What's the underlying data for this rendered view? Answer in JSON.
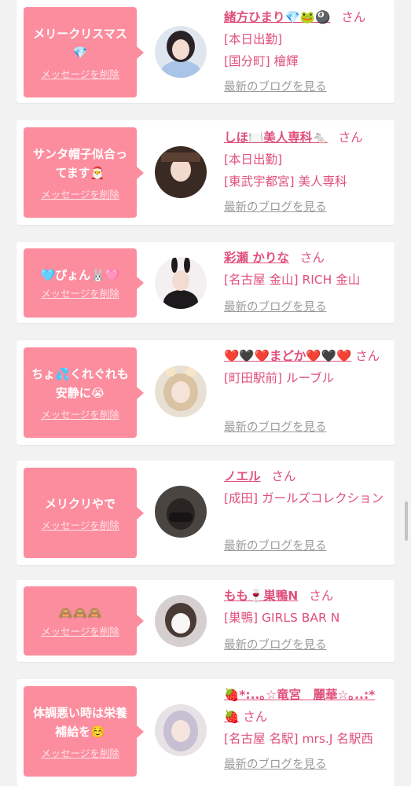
{
  "delete_label": "メッセージを削除",
  "san_label": "さん",
  "blog_label": "最新のブログを見る",
  "colors": {
    "bubble": "#fc8d9e",
    "accent": "#e0507a",
    "muted": "#9a9a9a",
    "card": "#ffffff",
    "page": "#f2f2f2"
  },
  "cards": [
    {
      "message": "メリークリスマス💎",
      "name": "緒方ひまり💎🐸🎱",
      "lines": [
        "[本日出勤]",
        "[国分町] 檜輝"
      ]
    },
    {
      "message": "サンタ帽子似合ってます🎅",
      "name": "しほ🍽️美人専科🐁",
      "lines": [
        "[本日出勤]",
        "[東武宇都宮] 美人専科"
      ]
    },
    {
      "message": "🩵ぴょん🐰🩷",
      "name": "彩瀬 かりな",
      "lines": [
        "[名古屋 金山] RICH 金山"
      ]
    },
    {
      "message": "ちょ💦くれぐれも安静に😭",
      "name": "❤️🖤❤️まどか❤️🖤❤️",
      "lines": [
        "[町田駅前] ルーブル"
      ]
    },
    {
      "message": "メリクリやで",
      "name": "ノエル",
      "lines": [
        "[成田] ガールズコレクション"
      ]
    },
    {
      "message": "🙈🙈🙈",
      "name": "もも🍷巣鴨N",
      "lines": [
        "[巣鴨] GIRLS BAR N"
      ]
    },
    {
      "message": "体調悪い時は栄養補給を☺️",
      "name": "🍓*:..｡☆竜宮　麗華☆｡..:*🍓",
      "lines": [
        "[名古屋 名駅] mrs.J 名駅西"
      ]
    }
  ]
}
